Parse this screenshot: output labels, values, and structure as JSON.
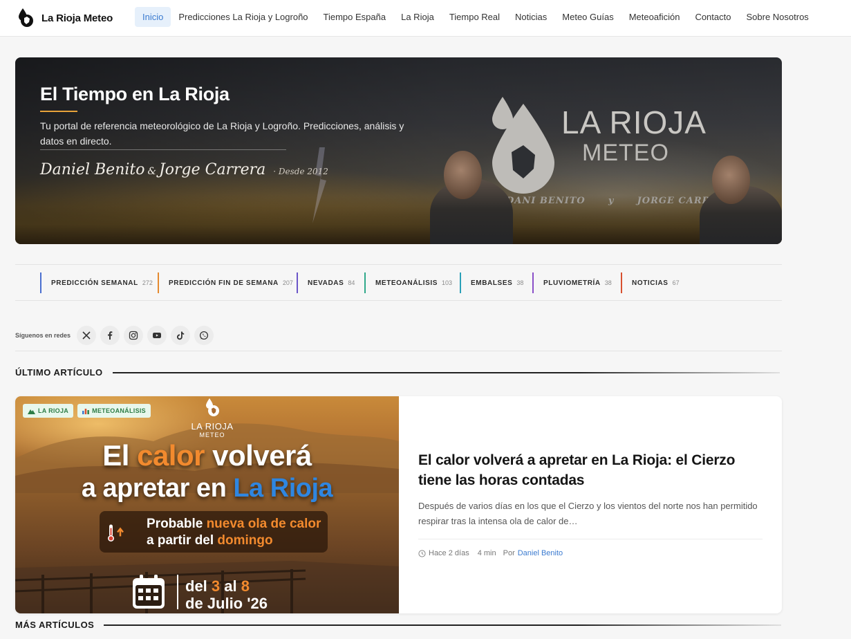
{
  "header": {
    "brand_name": "La Rioja Meteo",
    "nav": [
      {
        "label": "Inicio",
        "active": true
      },
      {
        "label": "Predicciones La Rioja y Logroño"
      },
      {
        "label": "Tiempo España"
      },
      {
        "label": "La Rioja"
      },
      {
        "label": "Tiempo Real"
      },
      {
        "label": "Noticias"
      },
      {
        "label": "Meteo Guías"
      },
      {
        "label": "Meteoafición"
      },
      {
        "label": "Contacto"
      },
      {
        "label": "Sobre Nosotros"
      }
    ],
    "active_color": "#3b7bd0"
  },
  "hero": {
    "title": "El Tiempo en La Rioja",
    "subtitle": "Tu portal de referencia meteorológico de La Rioja y Logroño. Predicciones, análisis y datos en directo.",
    "author1": "Daniel Benito",
    "amp": "&",
    "author2": "Jorge Carrera",
    "since": "· Desde 2012",
    "image_brand_line1": "LA RIOJA",
    "image_brand_line2": "METEO",
    "image_names_left": "DANI BENITO",
    "image_names_mid": "y",
    "image_names_right": "JORGE CARRERA",
    "accent_color": "#e8a33a"
  },
  "categories": [
    {
      "label": "PREDICCIÓN SEMANAL",
      "count": "272",
      "color": "#4a6fd0"
    },
    {
      "label": "PREDICCIÓN FIN DE SEMANA",
      "count": "207",
      "color": "#e58a2e"
    },
    {
      "label": "NEVADAS",
      "count": "84",
      "color": "#6a55c8"
    },
    {
      "label": "METEOANÁLISIS",
      "count": "103",
      "color": "#2fa88a"
    },
    {
      "label": "EMBALSES",
      "count": "38",
      "color": "#2aa0b8"
    },
    {
      "label": "PLUVIOMETRÍA",
      "count": "38",
      "color": "#8a4fc8"
    },
    {
      "label": "NOTICIAS",
      "count": "67",
      "color": "#d8502f"
    }
  ],
  "social": {
    "label": "Síguenos en redes",
    "icons": [
      "x-icon",
      "facebook-icon",
      "instagram-icon",
      "youtube-icon",
      "tiktok-icon",
      "whatsapp-icon"
    ]
  },
  "latest": {
    "section_title": "ÚLTIMO ARTÍCULO",
    "badges": [
      {
        "icon": "mountain-icon",
        "label": "LA RIOJA"
      },
      {
        "icon": "chart-icon",
        "label": "METEOANÁLISIS"
      }
    ],
    "image_logo_line1": "LA RIOJA",
    "image_logo_line2": "METEO",
    "image_headline_part1": "El ",
    "image_headline_hl": "calor",
    "image_headline_part2": " volverá",
    "image_headline2_part1": "a apretar en ",
    "image_headline2_hl": "La Rioja",
    "image_box_line1_a": "Probable ",
    "image_box_line1_hl": "nueva ola de calor",
    "image_box_line2_a": "a partir del ",
    "image_box_line2_hl": "domingo",
    "image_date_line1_a": "del ",
    "image_date_n1": "3",
    "image_date_mid": " al ",
    "image_date_n2": "8",
    "image_date_line2": "de Julio '26",
    "title": "El calor volverá a apretar en La Rioja: el Cierzo tiene las horas contadas",
    "excerpt": "Después de varios días en los que el Cierzo y los vientos del norte nos han permitido respirar tras la intensa ola de calor de…",
    "time_ago": "Hace 2 días",
    "read_time": "4 min",
    "by_label": "Por",
    "author": "Daniel Benito"
  },
  "more": {
    "section_title": "MÁS ARTÍCULOS"
  }
}
